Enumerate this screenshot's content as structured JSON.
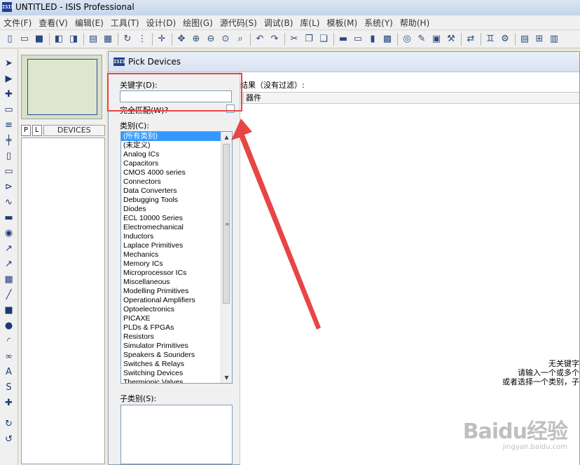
{
  "window": {
    "title": "UNTITLED - ISIS Professional",
    "logo": "ISIS"
  },
  "menu": [
    "文件(F)",
    "查看(V)",
    "编辑(E)",
    "工具(T)",
    "设计(D)",
    "绘图(G)",
    "源代码(S)",
    "调试(B)",
    "库(L)",
    "模板(M)",
    "系统(Y)",
    "帮助(H)"
  ],
  "left_panel": {
    "tab_p": "P",
    "tab_l": "L",
    "devices_header": "DEVICES"
  },
  "dialog": {
    "title": "Pick Devices",
    "logo": "ISIS",
    "keyword_label": "关键字(D):",
    "keyword_value": "",
    "exact_match_label": "完全匹配(W)?",
    "category_label": "类别(C):",
    "categories": [
      "(所有类别)",
      "(未定义)",
      "Analog ICs",
      "Capacitors",
      "CMOS 4000 series",
      "Connectors",
      "Data Converters",
      "Debugging Tools",
      "Diodes",
      "ECL 10000 Series",
      "Electromechanical",
      "Inductors",
      "Laplace Primitives",
      "Mechanics",
      "Memory ICs",
      "Microprocessor ICs",
      "Miscellaneous",
      "Modelling Primitives",
      "Operational Amplifiers",
      "Optoelectronics",
      "PICAXE",
      "PLDs & FPGAs",
      "Resistors",
      "Simulator Primitives",
      "Speakers & Sounders",
      "Switches & Relays",
      "Switching Devices",
      "Thermionic Valves"
    ],
    "selected_category_index": 0,
    "subcategory_label": "子类别(S):",
    "results_label": "结果（没有过滤）:",
    "results_column": "器件",
    "no_results_lines": [
      "无关键字",
      "请输入一个或多个",
      "或者选择一个类别，子"
    ]
  },
  "watermark": {
    "brand": "Baidu经验",
    "url": "jingyan.baidu.com"
  },
  "colors": {
    "annotation": "#e84545",
    "selection": "#3399ff"
  }
}
